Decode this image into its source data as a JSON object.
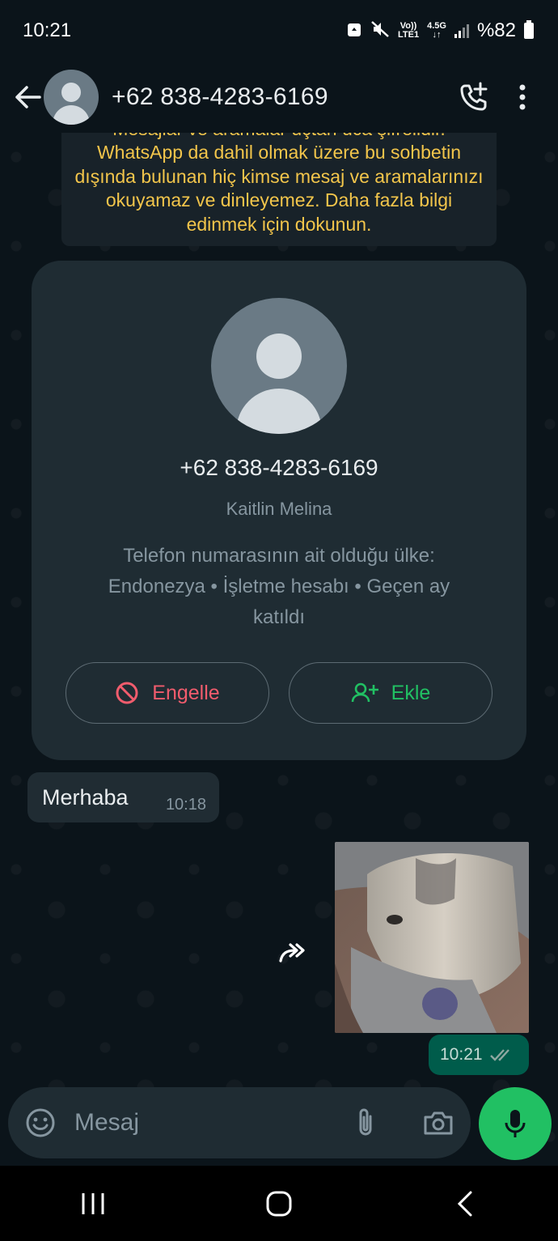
{
  "status_bar": {
    "time": "10:21",
    "volte": "Vo))",
    "lte": "LTE1",
    "network": "4.5G",
    "battery": "%82"
  },
  "header": {
    "title": "+62 838-4283-6169"
  },
  "encryption_notice": {
    "text": "Mesajlar ve aramalar uçtan uca şifrelidir. WhatsApp da dahil olmak üzere bu sohbetin dışında bulunan hiç kimse mesaj ve aramalarınızı okuyamaz ve dinleyemez. Daha fazla bilgi edinmek için dokunun."
  },
  "profile_card": {
    "number": "+62 838-4283-6169",
    "name": "Kaitlin Melina",
    "info": "Telefon numarasının ait olduğu ülke: Endonezya • İşletme hesabı • Geçen ay katıldı",
    "block_label": "Engelle",
    "add_label": "Ekle"
  },
  "messages": [
    {
      "direction": "incoming",
      "text": "Merhaba",
      "time": "10:18"
    },
    {
      "direction": "outgoing",
      "type": "image",
      "time": "10:21",
      "status": "read"
    }
  ],
  "input": {
    "placeholder": "Mesaj"
  },
  "colors": {
    "accent": "#21c063",
    "danger": "#f15c6d",
    "outgoing_bubble": "#005c4b",
    "incoming_bubble": "#202c33",
    "notice_text": "#f2c54b"
  }
}
